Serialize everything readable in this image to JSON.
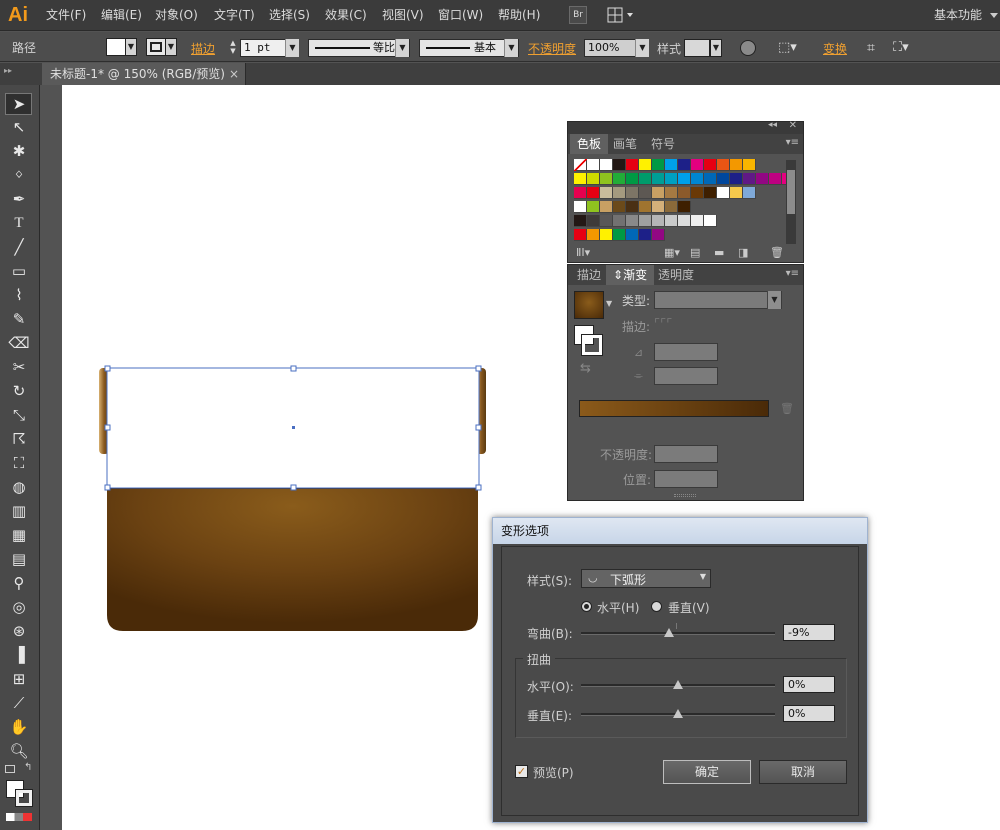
{
  "app": {
    "logo": "Ai",
    "workspace": "基本功能"
  },
  "menu": [
    "文件(F)",
    "编辑(E)",
    "对象(O)",
    "文字(T)",
    "选择(S)",
    "效果(C)",
    "视图(V)",
    "窗口(W)",
    "帮助(H)"
  ],
  "bridge_label": "Br",
  "control": {
    "selection_label": "路径",
    "stroke_label": "描边",
    "stroke_weight": "1 pt",
    "profile_label": "等比",
    "brush_label": "基本",
    "opacity_label": "不透明度",
    "opacity_value": "100%",
    "style_label": "样式",
    "transform_label": "变换"
  },
  "document": {
    "tab_title": "未标题-1* @ 150% (RGB/预览)",
    "close": "×"
  },
  "swatches_panel": {
    "tabs": [
      "色板",
      "画笔",
      "符号"
    ],
    "rows": [
      [
        "#ffffff",
        "#ffffff",
        "#ffffff",
        "#231815",
        "#e60012",
        "#fff100",
        "#009944",
        "#00a0e9",
        "#1d2088",
        "#e4007f",
        "#e60012",
        "#ea5514",
        "#f39800",
        "#f8b500"
      ],
      [
        "#fff100",
        "#cfdb00",
        "#8fc31f",
        "#22ac38",
        "#009944",
        "#009b6b",
        "#009e96",
        "#00a0c1",
        "#00a0e9",
        "#0086d1",
        "#0068b7",
        "#00479d",
        "#1d2088",
        "#601986",
        "#920783",
        "#be0081",
        "#e4007f"
      ],
      [
        "#e5004f",
        "#e60012",
        "#c9bc9c",
        "#a49a7f",
        "#7d7566",
        "#5d5853",
        "#c8a063",
        "#a57942",
        "#8b5a2b",
        "#6a3906",
        "#3e1f00",
        "#ffffff",
        "#f6c94c",
        "#7fa9d8"
      ],
      [
        "#ffffff",
        "#8fc31f",
        "#c8a063",
        "#6b4a1a",
        "#4a3014",
        "#a0742f",
        "#d4b07a",
        "#8b6a3a",
        "#3e1f00"
      ],
      [
        "#231815",
        "#3e3a39",
        "#595757",
        "#727171",
        "#898989",
        "#9fa0a0",
        "#b5b5b6",
        "#c9caca",
        "#dcdddd",
        "#efefef",
        "#ffffff"
      ],
      [
        "#e60012",
        "#f39800",
        "#fff100",
        "#009944",
        "#0068b7",
        "#1d2088",
        "#920783"
      ]
    ]
  },
  "gradient_panel": {
    "tabs": [
      "描边",
      "渐变",
      "透明度"
    ],
    "type_label": "类型:",
    "stroke_label": "描边:",
    "opacity_label": "不透明度:",
    "location_label": "位置:",
    "gradient_colors": [
      "#8b5a1a",
      "#4a2a08"
    ]
  },
  "warp_dialog": {
    "title": "变形选项",
    "style_label": "样式(S):",
    "style_value": "下弧形",
    "horizontal_label": "水平(H)",
    "vertical_label": "垂直(V)",
    "orientation_selected": "horizontal",
    "bend_label": "弯曲(B):",
    "bend_value": "-9%",
    "bend_fraction": 0.455,
    "distortion_group": "扭曲",
    "dist_h_label": "水平(O):",
    "dist_h_value": "0%",
    "dist_h_fraction": 0.5,
    "dist_v_label": "垂直(E):",
    "dist_v_value": "0%",
    "dist_v_fraction": 0.5,
    "preview_label": "预览(P)",
    "preview_checked": true,
    "ok_label": "确定",
    "cancel_label": "取消"
  },
  "artwork": {
    "body_colors": [
      "#8a5c1b",
      "#6b4212",
      "#4a2a08"
    ]
  }
}
